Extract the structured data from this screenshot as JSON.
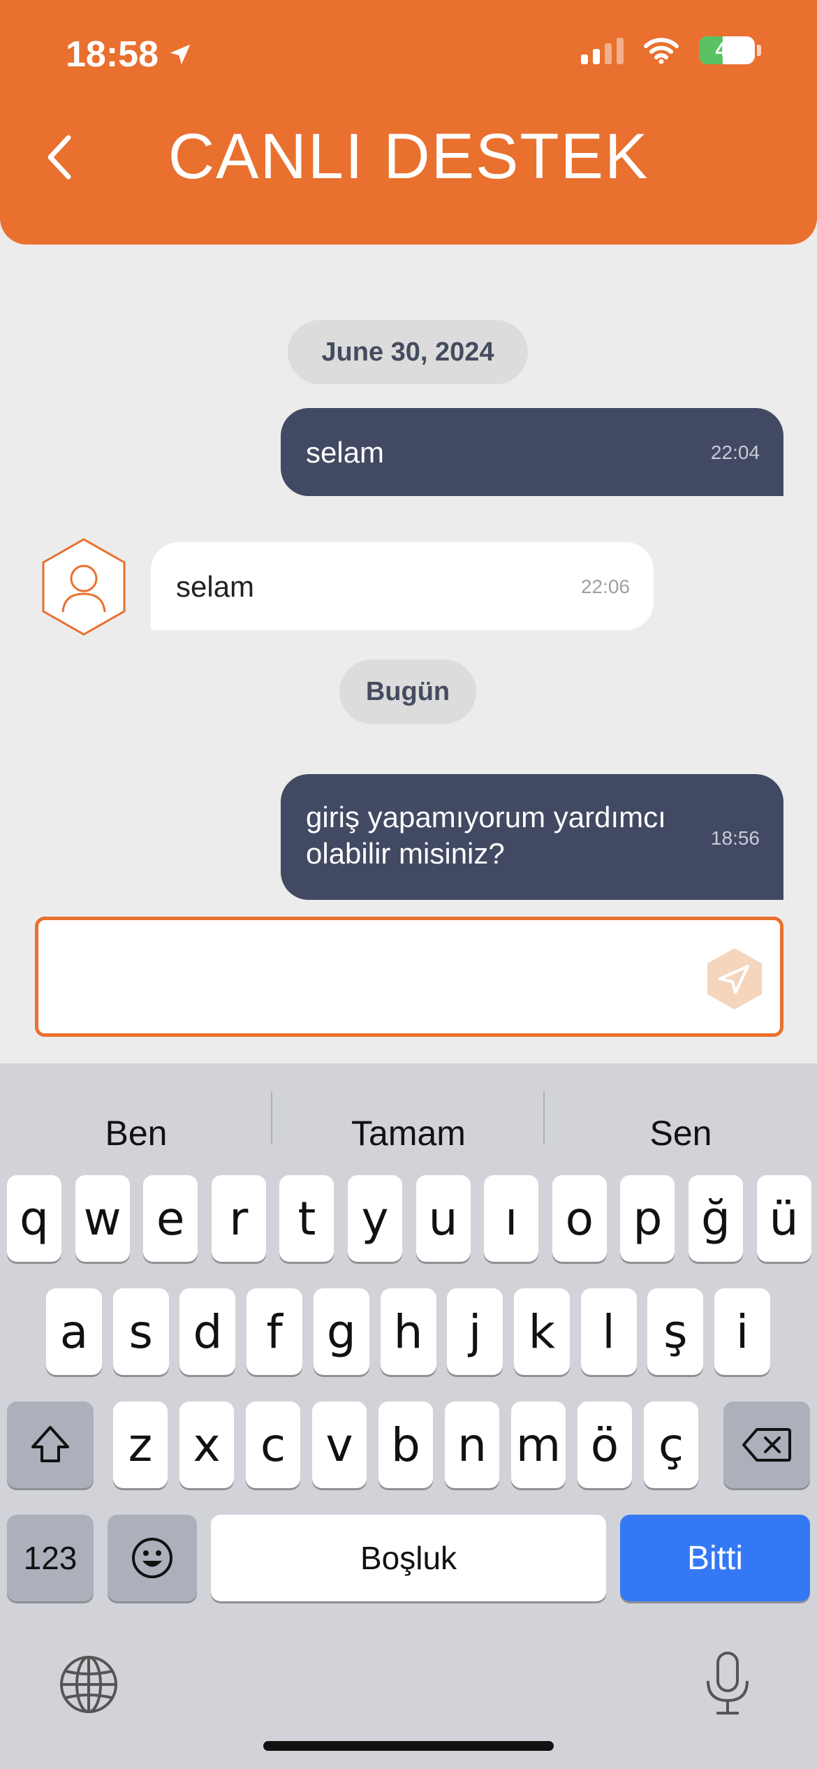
{
  "status_bar": {
    "time": "18:58",
    "battery": "42"
  },
  "header": {
    "title": "CANLI DESTEK"
  },
  "chat": {
    "date1": "June 30, 2024",
    "msg1": {
      "text": "selam",
      "time": "22:04"
    },
    "msg2": {
      "text": "selam",
      "time": "22:06"
    },
    "date2": "Bugün",
    "msg3": {
      "line1": "giriş yapamıyorum yardımcı",
      "line2": "olabilir misiniz?",
      "time": "18:56"
    }
  },
  "input": {
    "value": ""
  },
  "keyboard": {
    "suggestions": [
      "Ben",
      "Tamam",
      "Sen"
    ],
    "row1": [
      "q",
      "w",
      "e",
      "r",
      "t",
      "y",
      "u",
      "ı",
      "o",
      "p",
      "ğ",
      "ü"
    ],
    "row2": [
      "a",
      "s",
      "d",
      "f",
      "g",
      "h",
      "j",
      "k",
      "l",
      "ş",
      "i"
    ],
    "row3": [
      "z",
      "x",
      "c",
      "v",
      "b",
      "n",
      "m",
      "ö",
      "ç"
    ],
    "num_label": "123",
    "space_label": "Boşluk",
    "done_label": "Bitti"
  },
  "colors": {
    "accent": "#e9702e",
    "outgoing": "#424962",
    "done": "#3478f6"
  }
}
